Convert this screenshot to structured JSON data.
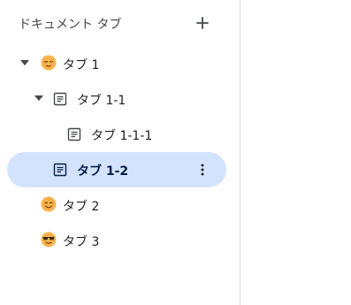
{
  "sidebar": {
    "header": {
      "title": "ドキュメント タブ"
    },
    "tabs": [
      {
        "label": "タブ 1",
        "icon": "relieved-face-emoji",
        "expanded": true
      },
      {
        "label": "タブ 1-1",
        "icon": "document-icon",
        "expanded": true
      },
      {
        "label": "タブ 1-1-1",
        "icon": "document-icon"
      },
      {
        "label": "タブ 1-2",
        "icon": "document-icon",
        "selected": true
      },
      {
        "label": "タブ 2",
        "icon": "smiling-face-emoji"
      },
      {
        "label": "タブ 3",
        "icon": "sunglasses-face-emoji"
      }
    ]
  },
  "colors": {
    "selected_bg": "#d3e3fd",
    "divider": "#dadce0",
    "emoji_yellow": "#f8b34a"
  }
}
